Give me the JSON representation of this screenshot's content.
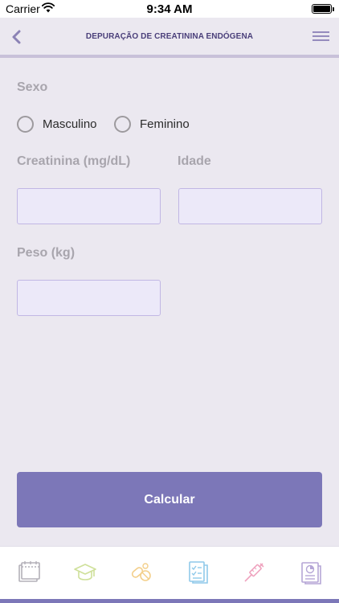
{
  "status": {
    "carrier": "Carrier",
    "time": "9:34 AM"
  },
  "header": {
    "title": "DEPURAÇÃO DE CREATININA ENDÓGENA"
  },
  "form": {
    "sex_label": "Sexo",
    "options": [
      "Masculino",
      "Feminino"
    ],
    "creatinine_label": "Creatinina (mg/dL)",
    "creatinine_value": "",
    "age_label": "Idade",
    "age_value": "",
    "weight_label": "Peso (kg)",
    "weight_value": ""
  },
  "actions": {
    "calculate": "Calcular"
  },
  "tabs": [
    {
      "icon": "calendar-icon",
      "color": "#b3b0b8"
    },
    {
      "icon": "graduation-cap-icon",
      "color": "#cfe09a"
    },
    {
      "icon": "pills-icon",
      "color": "#f3cf8a"
    },
    {
      "icon": "checklist-document-icon",
      "color": "#8fc9ea"
    },
    {
      "icon": "syringe-icon",
      "color": "#efa4bf"
    },
    {
      "icon": "report-chart-icon",
      "color": "#b5a6d6"
    }
  ],
  "colors": {
    "accent": "#7c77b8",
    "title": "#4a3f7a",
    "background": "#ebe8f0"
  }
}
